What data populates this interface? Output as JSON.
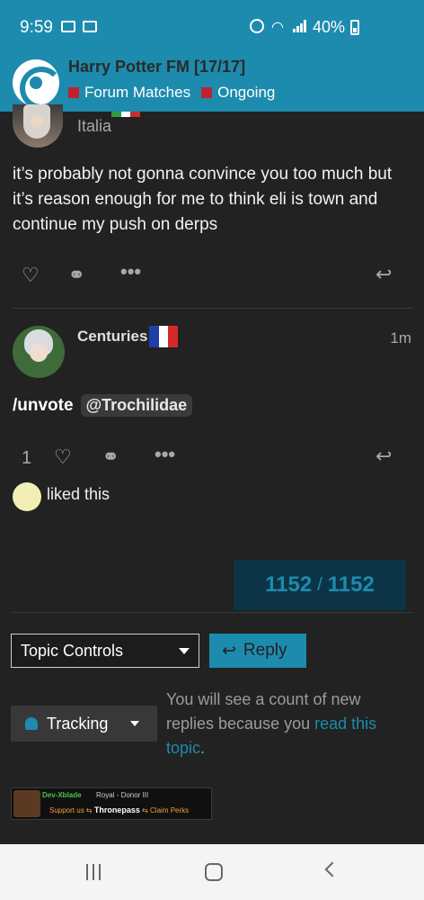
{
  "status": {
    "time": "9:59",
    "battery": "40%",
    "icons": [
      "mail-icon",
      "mail-icon",
      "alarm-icon",
      "wifi-icon",
      "signal-icon",
      "battery-icon"
    ]
  },
  "header": {
    "title": "Harry Potter FM [17/17]",
    "category": "Forum Matches",
    "tag": "Ongoing",
    "category_color": "#c0212f",
    "accent": "#1d8bad"
  },
  "post1": {
    "location": "Italia",
    "text": "it’s probably not gonna convince you too much but it’s reason enough for me to think eli is town and continue my push on derps"
  },
  "post2": {
    "author": "Centuries",
    "time": "1m",
    "command": "/unvote",
    "mention": "@Trochilidae",
    "like_count": "1",
    "liked_text": "liked this"
  },
  "progress": {
    "current": "1152",
    "separator": "/",
    "total": "1152"
  },
  "controls": {
    "topic_controls_label": "Topic Controls",
    "reply_label": "Reply",
    "tracking_label": "Tracking",
    "tracking_desc_prefix": "You will see a count of new replies because you ",
    "tracking_desc_link": "read this topic",
    "tracking_desc_suffix": "."
  },
  "signature": {
    "name": "Dev-Xblade",
    "role": "Royal - Donor III",
    "support": "Support us",
    "brand": "Thronepass",
    "claim": "Claim Perks"
  }
}
